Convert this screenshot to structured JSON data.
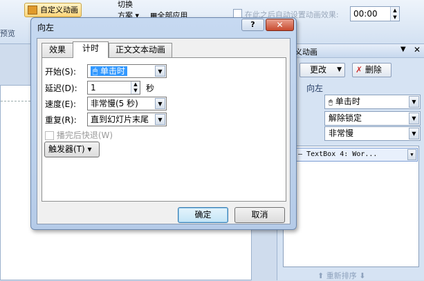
{
  "ribbon": {
    "custom_animation": "自定义动画",
    "switch": "切换",
    "scheme": "方案",
    "apply_all": "全部应用",
    "auto_after": "在此之后自动设置动画效果:",
    "time_value": "00:00",
    "preview_fragment": "预览"
  },
  "task_pane": {
    "title": "义动画",
    "change": "更改",
    "delete": "删除",
    "direction": "向左",
    "start_value": "单击时",
    "property_value": "解除锁定",
    "speed_value": "非常慢",
    "list_item": "— TextBox 4: Wor...",
    "reorder": "重新排序"
  },
  "dialog": {
    "title": "向左",
    "help": "?",
    "close": "✕",
    "tabs": [
      "效果",
      "计时",
      "正文文本动画"
    ],
    "start_label": "开始(S):",
    "start_value": "单击时",
    "delay_label": "延迟(D):",
    "delay_value": "1",
    "delay_unit": "秒",
    "speed_label": "速度(E):",
    "speed_value": "非常慢(5 秒)",
    "repeat_label": "重复(R):",
    "repeat_value": "直到幻灯片末尾",
    "rewind_label": "播完后快退(W)",
    "triggers": "触发器(T)",
    "ok": "确定",
    "cancel": "取消"
  }
}
